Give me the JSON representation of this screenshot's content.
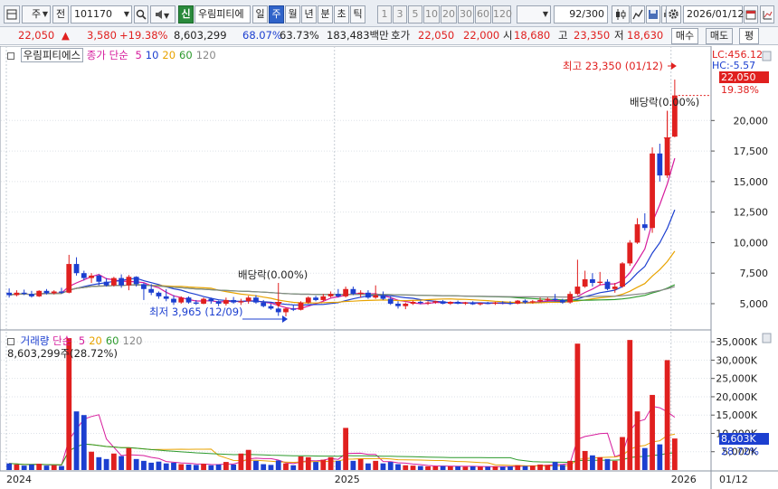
{
  "toolbar": {
    "market": "주",
    "prev": "전",
    "code": "101170",
    "badge": "신",
    "name": "우림피티에",
    "periods": [
      {
        "label": "일",
        "active": false
      },
      {
        "label": "주",
        "active": true
      },
      {
        "label": "월",
        "active": false
      },
      {
        "label": "년",
        "active": false
      },
      {
        "label": "분",
        "active": false
      },
      {
        "label": "초",
        "active": false
      },
      {
        "label": "틱",
        "active": false
      }
    ],
    "intervals": [
      "1",
      "3",
      "5",
      "10",
      "20",
      "30",
      "60",
      "120"
    ],
    "count": "92",
    "count_total": "/300",
    "date": "2026/01/12"
  },
  "quote": {
    "price": "22,050",
    "change_arrow": "▲",
    "change": "3,580",
    "change_pct": "+19.38%",
    "volume": "8,603,299",
    "ratio1": "68.07%",
    "ratio2": "63.73%",
    "amount": "183,483백만",
    "bid_label": "호가",
    "bid1": "22,050",
    "bid2": "22,000",
    "open_label": "시",
    "open": "18,680",
    "high_label": "고",
    "high": "23,350",
    "low_label": "저",
    "low": "18,630",
    "buy_btn": "매수",
    "sell_btn": "매도",
    "eval_btn": "평"
  },
  "price_panel": {
    "legend_name": "우림피티에스",
    "legend_series": "종가 단순",
    "ma": [
      {
        "label": "5",
        "color": "#d61c9c"
      },
      {
        "label": "10",
        "color": "#1c3fd0"
      },
      {
        "label": "20",
        "color": "#e8a300"
      },
      {
        "label": "60",
        "color": "#2c9a2c"
      },
      {
        "label": "120",
        "color": "#888888"
      }
    ],
    "lc": "LC:456.12",
    "hc": "HC:-5.57",
    "cur_price": "22,050",
    "cur_pct": "19.38%",
    "high_annot": "최고 23,350 (01/12)",
    "low_annot": "최저 3,965 (12/09)",
    "div1": "배당락(0.00%)",
    "div2": "배당락(0.00%)"
  },
  "volume_panel": {
    "legend_name": "거래량",
    "legend_series": "단순",
    "ma": [
      {
        "label": "5",
        "color": "#d61c9c"
      },
      {
        "label": "20",
        "color": "#e8a300"
      },
      {
        "label": "60",
        "color": "#2c9a2c"
      },
      {
        "label": "120",
        "color": "#888888"
      }
    ],
    "stat": "8,603,299주(28.72%)",
    "cur_vol": "8,603K",
    "cur_pct": "28.72%"
  },
  "x_axis": {
    "labels": [
      "2024",
      "2025",
      "2026"
    ],
    "last": "01/12"
  },
  "chart_data": {
    "type": "candlestick",
    "price_ylim": [
      3000,
      25500
    ],
    "price_ticks": [
      5000,
      7500,
      10000,
      12500,
      15000,
      17500,
      20000
    ],
    "price_tick_labels": [
      "5,000",
      "7,500",
      "10,000",
      "12,500",
      "15,000",
      "17,500",
      "20,000"
    ],
    "volume_ylim": [
      0,
      38000
    ],
    "volume_ticks": [
      5000,
      10000,
      15000,
      20000,
      25000,
      30000,
      35000
    ],
    "volume_tick_labels": [
      "5,000K",
      "10,000K",
      "15,000K",
      "20,000K",
      "25,000K",
      "30,000K",
      "35,000K"
    ],
    "candles": [
      [
        5900,
        6250,
        5500,
        5700,
        1800
      ],
      [
        5700,
        6100,
        5600,
        5900,
        1500
      ],
      [
        5900,
        6150,
        5700,
        5800,
        1200
      ],
      [
        5800,
        6050,
        5500,
        5600,
        1500
      ],
      [
        5600,
        6100,
        5550,
        6050,
        1700
      ],
      [
        6050,
        6200,
        5750,
        5850,
        1200
      ],
      [
        5850,
        6100,
        5750,
        6000,
        1300
      ],
      [
        6000,
        6300,
        5800,
        5900,
        1100
      ],
      [
        5900,
        9000,
        5850,
        8250,
        36000
      ],
      [
        8250,
        8800,
        7300,
        7500,
        16000
      ],
      [
        7500,
        7700,
        6900,
        7100,
        15000
      ],
      [
        7100,
        7500,
        6700,
        7300,
        5000
      ],
      [
        7300,
        7400,
        6500,
        6800,
        3500
      ],
      [
        6800,
        7100,
        6400,
        6500,
        3000
      ],
      [
        6500,
        7200,
        6400,
        7100,
        4500
      ],
      [
        7100,
        7400,
        6300,
        6500,
        3800
      ],
      [
        6500,
        7350,
        6100,
        7200,
        6000
      ],
      [
        7200,
        7250,
        6400,
        6600,
        3000
      ],
      [
        6600,
        6700,
        5300,
        6200,
        2500
      ],
      [
        6200,
        6600,
        5700,
        5900,
        2000
      ],
      [
        5900,
        6000,
        5400,
        5600,
        2300
      ],
      [
        5600,
        6200,
        5200,
        5400,
        1800
      ],
      [
        5400,
        5700,
        4900,
        5100,
        2000
      ],
      [
        5100,
        5600,
        5000,
        5500,
        1600
      ],
      [
        5500,
        5600,
        5000,
        5100,
        1500
      ],
      [
        5100,
        5300,
        4900,
        5000,
        1400
      ],
      [
        5000,
        5500,
        4950,
        5400,
        1700
      ],
      [
        5400,
        5500,
        5000,
        5200,
        1300
      ],
      [
        5200,
        5250,
        4800,
        5000,
        1500
      ],
      [
        5000,
        5500,
        4850,
        5300,
        2200
      ],
      [
        5300,
        5550,
        5000,
        5100,
        1500
      ],
      [
        5100,
        5400,
        4900,
        5200,
        4500
      ],
      [
        5200,
        5650,
        5000,
        5500,
        5500
      ],
      [
        5500,
        5700,
        5000,
        5100,
        2500
      ],
      [
        5100,
        5300,
        4700,
        4800,
        1600
      ],
      [
        4800,
        5000,
        4500,
        4600,
        1400
      ],
      [
        4600,
        4700,
        4000,
        4300,
        2600
      ],
      [
        4300,
        4700,
        3965,
        4600,
        1800
      ],
      [
        4600,
        4900,
        4400,
        4500,
        1300
      ],
      [
        4500,
        5200,
        4450,
        5100,
        3700
      ],
      [
        5100,
        5600,
        5000,
        5500,
        3500
      ],
      [
        5500,
        5650,
        5200,
        5300,
        2200
      ],
      [
        5300,
        5800,
        5200,
        5600,
        2800
      ],
      [
        5600,
        6000,
        5500,
        5800,
        3500
      ],
      [
        5800,
        6200,
        5500,
        5600,
        2500
      ],
      [
        5600,
        6400,
        5500,
        6200,
        11500
      ],
      [
        6200,
        6400,
        5700,
        5800,
        2500
      ],
      [
        5800,
        6100,
        5500,
        5900,
        3000
      ],
      [
        5900,
        6100,
        5400,
        5500,
        1800
      ],
      [
        5500,
        6500,
        5400,
        5700,
        2500
      ],
      [
        5700,
        6000,
        5300,
        5400,
        1800
      ],
      [
        5400,
        5600,
        4900,
        5000,
        2200
      ],
      [
        5000,
        5200,
        4600,
        4800,
        1600
      ],
      [
        4800,
        5100,
        4550,
        5000,
        1300
      ],
      [
        5000,
        5250,
        4900,
        5150,
        1200
      ],
      [
        5150,
        5250,
        4950,
        5050,
        1100
      ],
      [
        5050,
        5200,
        4900,
        5100,
        1000
      ],
      [
        5100,
        5250,
        5000,
        5200,
        1000
      ],
      [
        5200,
        5300,
        4950,
        5000,
        1100
      ],
      [
        5000,
        5200,
        4900,
        5150,
        1000
      ],
      [
        5150,
        5250,
        4950,
        5000,
        1000
      ],
      [
        5000,
        5150,
        4900,
        5100,
        900
      ],
      [
        5100,
        5200,
        4900,
        4950,
        1000
      ],
      [
        4950,
        5100,
        4850,
        5050,
        900
      ],
      [
        5050,
        5150,
        4950,
        5000,
        900
      ],
      [
        5000,
        5150,
        4900,
        5100,
        1000
      ],
      [
        5100,
        5200,
        4950,
        5050,
        900
      ],
      [
        5050,
        5200,
        4900,
        5000,
        1000
      ],
      [
        5000,
        5300,
        4950,
        5250,
        1300
      ],
      [
        5250,
        5350,
        5000,
        5100,
        1100
      ],
      [
        5100,
        5300,
        5000,
        5200,
        1200
      ],
      [
        5200,
        5500,
        5100,
        5300,
        1500
      ],
      [
        5300,
        5500,
        5200,
        5400,
        1400
      ],
      [
        5400,
        5800,
        5200,
        5300,
        2200
      ],
      [
        5300,
        5400,
        5000,
        5100,
        1400
      ],
      [
        5100,
        6000,
        5000,
        5800,
        2500
      ],
      [
        5800,
        8600,
        5700,
        6400,
        34500
      ],
      [
        6400,
        7700,
        6300,
        7000,
        5200
      ],
      [
        7000,
        7500,
        6400,
        6700,
        4000
      ],
      [
        6700,
        7600,
        6500,
        6800,
        3500
      ],
      [
        6800,
        7000,
        6100,
        6200,
        3000
      ],
      [
        6200,
        6700,
        5900,
        6400,
        2500
      ],
      [
        6400,
        8400,
        6300,
        8300,
        9000
      ],
      [
        8300,
        10200,
        8100,
        10000,
        35500
      ],
      [
        10000,
        12000,
        9900,
        11500,
        16000
      ],
      [
        11500,
        12400,
        11000,
        11200,
        6000
      ],
      [
        11200,
        17800,
        10800,
        17300,
        20500
      ],
      [
        17300,
        18100,
        15000,
        15500,
        7000
      ],
      [
        15500,
        20800,
        15300,
        18470,
        30000
      ],
      [
        18680,
        23350,
        18630,
        22050,
        8603
      ]
    ],
    "series": [
      {
        "name": "5",
        "color": "#d61c9c"
      },
      {
        "name": "10",
        "color": "#1c3fd0"
      },
      {
        "name": "20",
        "color": "#e8a300"
      },
      {
        "name": "60",
        "color": "#2c9a2c"
      },
      {
        "name": "120",
        "color": "#888888"
      }
    ]
  }
}
